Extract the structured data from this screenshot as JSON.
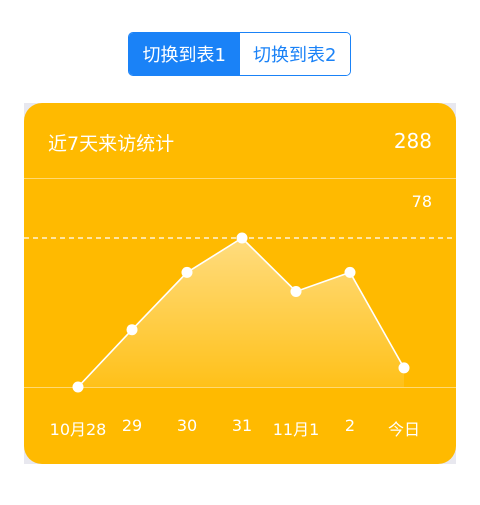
{
  "tabs": [
    {
      "label": "切换到表1",
      "active": true
    },
    {
      "label": "切换到表2",
      "active": false
    }
  ],
  "card": {
    "title": "近7天来访统计",
    "total": "288"
  },
  "chart_data": {
    "type": "area",
    "categories": [
      "10月28",
      "29",
      "30",
      "31",
      "11月1",
      "2",
      "今日"
    ],
    "values": [
      0,
      30,
      60,
      78,
      50,
      60,
      10
    ],
    "max_label": "78",
    "ylim": [
      0,
      78
    ],
    "xlabel": "",
    "ylabel": ""
  },
  "colors": {
    "accent": "#1a82f7",
    "card": "#ffba00"
  }
}
